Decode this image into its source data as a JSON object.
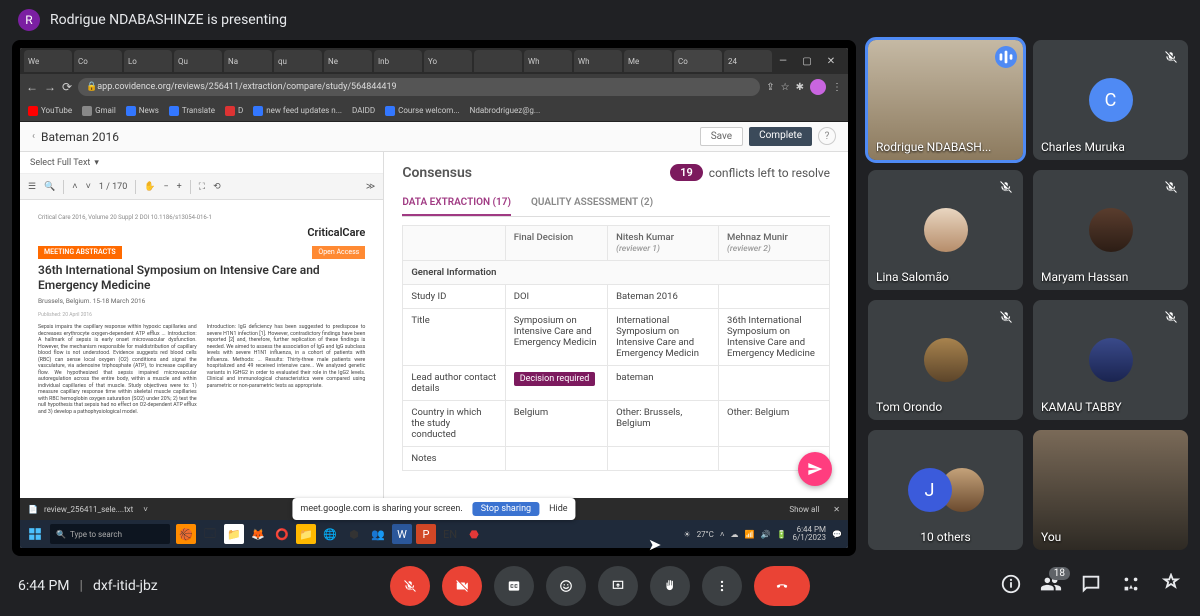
{
  "topbar": {
    "avatar_letter": "R",
    "presenting_text": "Rodrigue NDABASHINZE is presenting"
  },
  "browser": {
    "tabs": [
      "We",
      "Co",
      "Lo",
      "Qu",
      "Na",
      "qu",
      "Ne",
      "Inb",
      "Yo",
      "",
      "Wh",
      "Wh",
      "Me",
      "Co",
      "24"
    ],
    "url": "app.covidence.org/reviews/256411/extraction/compare/study/564844419",
    "bookmarks": [
      "YouTube",
      "Gmail",
      "News",
      "Translate",
      "D",
      "new feed updates n...",
      "DAIDD",
      "Course welcom...",
      "Ndabrodriguez@g..."
    ],
    "window_controls": {
      "min": "—",
      "max": "▢",
      "close": "✕"
    }
  },
  "covidence": {
    "study": "Bateman 2016",
    "save": "Save",
    "complete": "Complete",
    "select_full": "Select Full Text",
    "pdf": {
      "page_current": "1",
      "page_total": "170",
      "journal": "CriticalCare",
      "info": "Critical Care 2016, Volume 20 Suppl 2  DOI 10.1186/s13054-016-1",
      "badge_abs": "MEETING ABSTRACTS",
      "badge_open": "Open Access",
      "title": "36th International Symposium on Intensive Care and Emergency Medicine",
      "sub": "Brussels, Belgium. 15-18 March 2016",
      "pub": "Published: 20 April 2016",
      "col1": "Sepsis impairs the capillary response within hypoxic capillaries and decreases erythrocyte oxygen-dependent ATP efflux ... Introduction: A hallmark of sepsis is early onset microvascular dysfunction. However, the mechanism responsible for maldistribution of capillary blood flow is not understood. Evidence suggests red blood cells (RBC) can sense local oxygen (O2) conditions and signal the vasculature, via adenosine triphosphate (ATP), to increase capillary flow. We hypothesized that sepsis impaired microvascular autoregulation across the entire body, within a muscle and within individual capillaries of that muscle. Study objectives were to: 1) measure capillary response time within skeletal muscle capillaries with RBC hemoglobin oxygen saturation (SO2) under 20%; 2) test the null hypothesis that sepsis had no effect on O2-dependent ATP efflux and 3) develop a pathophysiological model.",
      "col2": "Introduction: IgG deficiency has been suggested to predispose to severe H1N1 infection [1]. However, contradictory findings have been reported [2] and, therefore, further replication of these findings is needed. We aimed to assess the association of IgG and IgG subclass levels with severe H1N1 influenza, in a cohort of patients with influenza. Methods: ... Results: Thirty-three male patients were hospitalized and 49 received intensive care... We analyzed genetic variants in IGHG2 in order to evaluated their role in the IgG2 levels. Clinical and immunological characteristics were compared using parametric or non-parametric tests as appropriate."
    },
    "consensus": {
      "title": "Consensus",
      "conflicts_num": "19",
      "conflicts_txt": "conflicts left to resolve",
      "tab_de": "DATA EXTRACTION (17)",
      "tab_qa": "QUALITY ASSESSMENT (2)",
      "th_final": "Final Decision",
      "reviewer1_name": "Nitesh Kumar",
      "reviewer1_role": "(reviewer 1)",
      "reviewer2_name": "Mehnaz Munir",
      "reviewer2_role": "(reviewer 2)",
      "section_gi": "General Information",
      "rows": {
        "study_id": {
          "label": "Study ID",
          "final": "DOI",
          "r1": "Bateman 2016",
          "r2": ""
        },
        "title": {
          "label": "Title",
          "final": "Symposium on Intensive Care and Emergency Medicin",
          "r1": "International Symposium on Intensive Care and Emergency Medicin",
          "r2": "36th International Symposium on Intensive Care and Emergency Medicine"
        },
        "lead": {
          "label": "Lead author contact details",
          "decision": "Decision required",
          "r1": "bateman",
          "r2": ""
        },
        "country": {
          "label": "Country in which the study conducted",
          "final": "Belgium",
          "r1": "Other: Brussels, Belgium",
          "r2": "Other: Belgium"
        },
        "notes": {
          "label": "Notes"
        }
      }
    }
  },
  "download": {
    "file": "review_256411_sele....txt",
    "showall": "Show all"
  },
  "sharing": {
    "text": "meet.google.com is sharing your screen.",
    "stop": "Stop sharing",
    "hide": "Hide"
  },
  "taskbar": {
    "search": "Type to search",
    "temp": "27°C",
    "time": "6:44 PM",
    "date": "6/1/2023"
  },
  "participants": [
    {
      "name": "Rodrigue NDABASH...",
      "speaking": true,
      "letter": "",
      "type": "video1"
    },
    {
      "name": "Charles Muruka",
      "letter": "C",
      "color": "#4f8af4",
      "muted": true
    },
    {
      "name": "Lina Salomão",
      "muted": true,
      "type": "photo1"
    },
    {
      "name": "Maryam Hassan",
      "muted": true,
      "type": "photo2"
    },
    {
      "name": "Tom Orondo",
      "muted": true,
      "type": "photo3"
    },
    {
      "name": "KAMAU TABBY",
      "muted": true,
      "type": "photo4"
    },
    {
      "name": "10 others",
      "overflow": true,
      "letter": "J"
    },
    {
      "name": "You",
      "type": "video2"
    }
  ],
  "meetbar": {
    "time": "6:44 PM",
    "code": "dxf-itid-jbz",
    "participant_count": "18"
  }
}
